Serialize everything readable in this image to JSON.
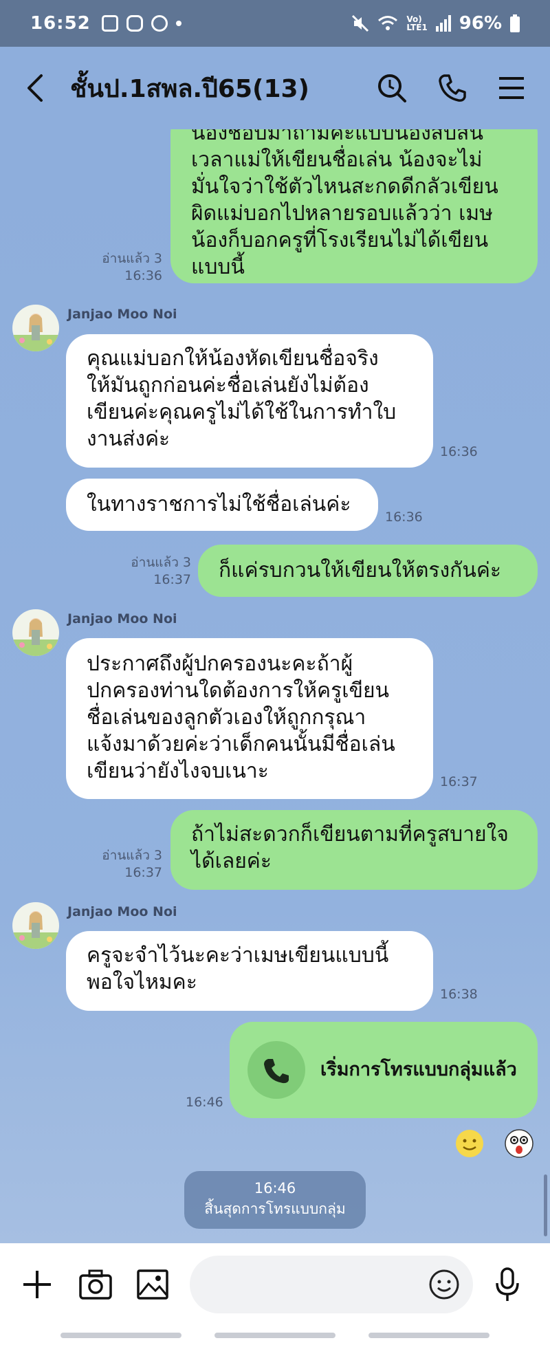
{
  "status_bar": {
    "time": "16:52",
    "battery": "96%",
    "network": "LTE1",
    "icons": [
      "gallery-icon",
      "instagram-icon",
      "line-icon",
      "dot-icon",
      "mute-icon",
      "wifi-icon",
      "volte-icon",
      "signal-icon",
      "battery-icon"
    ]
  },
  "header": {
    "title": "ชั้นป.1สพล.ปี65(13)",
    "icons": [
      "back-arrow-icon",
      "search-icon",
      "phone-icon",
      "menu-icon"
    ]
  },
  "messages": [
    {
      "type": "outgoing",
      "lines": [
        "น้องชอบมาถามค่ะแบบน้องสับสน",
        "เวลาแม่ให้เขียนชื่อเล่น น้องจะไม่",
        "มั่นใจว่าใช้ตัวไหนสะกดดีกลัวเขียน",
        "ผิดแม่บอกไปหลายรอบแล้วว่า เมษ",
        "น้องก็บอกครูที่โรงเรียนไม่ได้เขียน",
        "แบบนี้"
      ],
      "read": "อ่านแล้ว 3",
      "time": "16:36"
    },
    {
      "type": "incoming",
      "sender": "Janjao Moo Noi",
      "lines": [
        "คุณแม่บอกให้น้องหัดเขียนชื่อจริง",
        "ให้มันถูกก่อนค่ะชื่อเล่นยังไม่ต้อง",
        "เขียนค่ะคุณครูไม่ได้ใช้ในการทำใบ",
        "งานส่งค่ะ"
      ],
      "time": "16:36"
    },
    {
      "type": "incoming",
      "lines": [
        "ในทางราชการไม่ใช้ชื่อเล่นค่ะ"
      ],
      "time": "16:36"
    },
    {
      "type": "outgoing",
      "lines": [
        "ก็แค่รบกวนให้เขียนให้ตรงกันค่ะ"
      ],
      "read": "อ่านแล้ว 3",
      "time": "16:37"
    },
    {
      "type": "incoming",
      "sender": "Janjao Moo Noi",
      "lines": [
        "ประกาศถึงผู้ปกครองนะคะถ้าผู้",
        "ปกครองท่านใดต้องการให้ครูเขียน",
        "ชื่อเล่นของลูกตัวเองให้ถูกกรุณา",
        "แจ้งมาด้วยค่ะว่าเด็กคนนั้นมีชื่อเล่น",
        "เขียนว่ายังไงจบเนาะ"
      ],
      "time": "16:37"
    },
    {
      "type": "outgoing",
      "lines": [
        "ถ้าไม่สะดวกก็เขียนตามที่ครูสบายใจ",
        "ได้เลยค่ะ"
      ],
      "read": "อ่านแล้ว 3",
      "time": "16:37"
    },
    {
      "type": "incoming",
      "sender": "Janjao Moo Noi",
      "lines": [
        "ครูจะจำไว้นะคะว่าเมษเขียนแบบนี้",
        "พอใจไหมคะ"
      ],
      "time": "16:38"
    },
    {
      "type": "outgoing_call",
      "label": "เริ่มการโทรแบบกลุ่มแล้ว",
      "time": "16:46"
    }
  ],
  "reactions": [
    "smile-emoji-icon",
    "shocked-face-icon"
  ],
  "call_ended": {
    "time": "16:46",
    "label": "สิ้นสุดการโทรแบบกลุ่ม"
  },
  "input_bar": {
    "placeholder": "",
    "icons": [
      "plus-icon",
      "camera-icon",
      "image-icon",
      "emoji-icon",
      "microphone-icon"
    ]
  },
  "colors": {
    "chat_background": "#8eaedc",
    "outgoing_bubble": "#9ce392",
    "incoming_bubble": "#ffffff",
    "status_bar": "#5f7594"
  }
}
